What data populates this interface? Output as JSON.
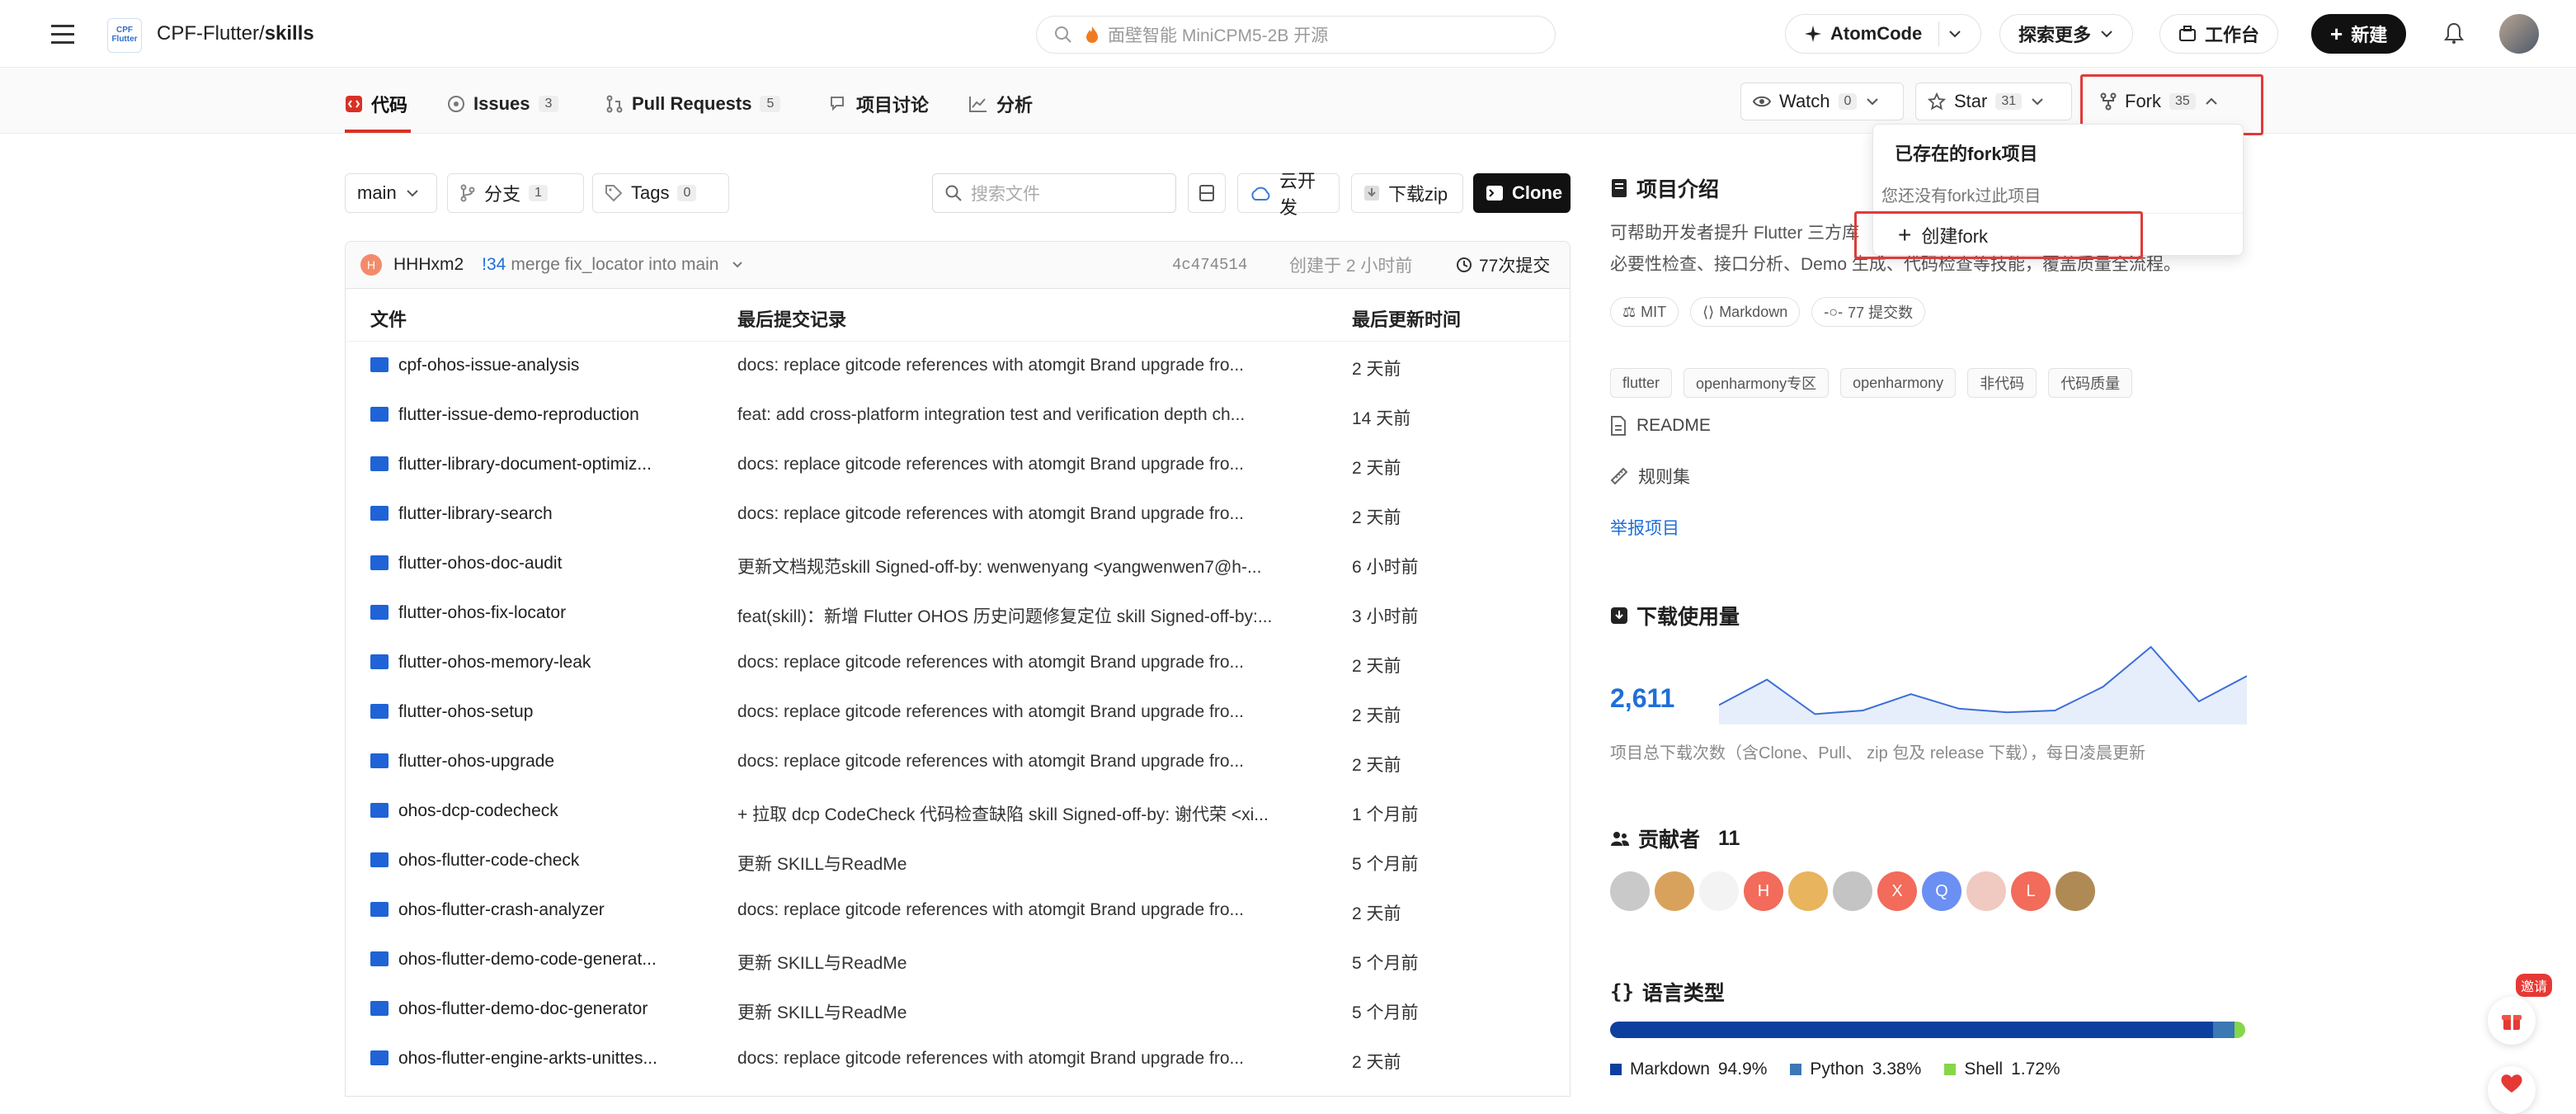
{
  "header": {
    "logo_text": "CPF Flutter",
    "repo_owner": "CPF-Flutter/",
    "repo_name": "skills",
    "search_placeholder": "面壁智能 MiniCPM5-2B 开源",
    "atomcode_label": "AtomCode",
    "explore_label": "探索更多",
    "workspace_label": "工作台",
    "new_label": "新建"
  },
  "tabs": [
    {
      "label": "代码",
      "count": ""
    },
    {
      "label": "Issues",
      "count": "3"
    },
    {
      "label": "Pull Requests",
      "count": "5"
    },
    {
      "label": "项目讨论",
      "count": ""
    },
    {
      "label": "分析",
      "count": ""
    }
  ],
  "repo_actions": {
    "watch_label": "Watch",
    "watch_count": "0",
    "star_label": "Star",
    "star_count": "31",
    "fork_label": "Fork",
    "fork_count": "35"
  },
  "fork_dropdown": {
    "title": "已存在的fork项目",
    "empty_text": "您还没有fork过此项目",
    "create_label": "创建fork"
  },
  "toolbar": {
    "branch": "main",
    "branches_label": "分支",
    "branches_count": "1",
    "tags_label": "Tags",
    "tags_count": "0",
    "file_search_placeholder": "搜索文件",
    "cloud_dev_label": "云开发",
    "download_zip_label": "下载zip",
    "clone_label": "Clone"
  },
  "commit": {
    "avatar_letter": "H",
    "author": "HHHxm2",
    "pr_ref": "!34",
    "message": "merge fix_locator into main",
    "hash": "4c474514",
    "created": "创建于 2 小时前",
    "commit_count": "77次提交"
  },
  "file_table": {
    "headers": [
      "文件",
      "最后提交记录",
      "最后更新时间"
    ],
    "rows": [
      {
        "name": "cpf-ohos-issue-analysis",
        "msg": "docs: replace gitcode references with atomgit Brand upgrade fro...",
        "time": "2 天前"
      },
      {
        "name": "flutter-issue-demo-reproduction",
        "msg": "feat: add cross-platform integration test and verification depth ch...",
        "time": "14 天前"
      },
      {
        "name": "flutter-library-document-optimiz...",
        "msg": "docs: replace gitcode references with atomgit Brand upgrade fro...",
        "time": "2 天前"
      },
      {
        "name": "flutter-library-search",
        "msg": "docs: replace gitcode references with atomgit Brand upgrade fro...",
        "time": "2 天前"
      },
      {
        "name": "flutter-ohos-doc-audit",
        "msg": "更新文档规范skill Signed-off-by: wenwenyang <yangwenwen7@h-...",
        "time": "6 小时前"
      },
      {
        "name": "flutter-ohos-fix-locator",
        "msg": "feat(skill)：新增 Flutter OHOS 历史问题修复定位 skill Signed-off-by:...",
        "time": "3 小时前"
      },
      {
        "name": "flutter-ohos-memory-leak",
        "msg": "docs: replace gitcode references with atomgit Brand upgrade fro...",
        "time": "2 天前"
      },
      {
        "name": "flutter-ohos-setup",
        "msg": "docs: replace gitcode references with atomgit Brand upgrade fro...",
        "time": "2 天前"
      },
      {
        "name": "flutter-ohos-upgrade",
        "msg": "docs: replace gitcode references with atomgit Brand upgrade fro...",
        "time": "2 天前"
      },
      {
        "name": "ohos-dcp-codecheck",
        "msg": "+ 拉取 dcp CodeCheck 代码检查缺陷 skill Signed-off-by: 谢代荣 <xi...",
        "time": "1 个月前"
      },
      {
        "name": "ohos-flutter-code-check",
        "msg": "更新 SKILL与ReadMe",
        "time": "5 个月前"
      },
      {
        "name": "ohos-flutter-crash-analyzer",
        "msg": "docs: replace gitcode references with atomgit Brand upgrade fro...",
        "time": "2 天前"
      },
      {
        "name": "ohos-flutter-demo-code-generat...",
        "msg": "更新 SKILL与ReadMe",
        "time": "5 个月前"
      },
      {
        "name": "ohos-flutter-demo-doc-generator",
        "msg": "更新 SKILL与ReadMe",
        "time": "5 个月前"
      },
      {
        "name": "ohos-flutter-engine-arkts-unittes...",
        "msg": "docs: replace gitcode references with atomgit Brand upgrade fro...",
        "time": "2 天前"
      }
    ]
  },
  "intro": {
    "title": "项目介绍",
    "desc_line1": "可帮助开发者提升 Flutter 三方库",
    "desc_line2": "必要性检查、接口分析、Demo 生成、代码检查等技能，覆盖质量全流程。",
    "license": "MIT",
    "language": "Markdown",
    "commits": "77 提交数",
    "topics": [
      "flutter",
      "openharmony专区",
      "openharmony",
      "非代码",
      "代码质量"
    ],
    "readme": "README",
    "rules": "规则集",
    "report": "举报项目"
  },
  "downloads": {
    "title": "下载使用量",
    "total": "2,611",
    "note": "项目总下载次数（含Clone、Pull、 zip 包及 release 下载），每日凌晨更新",
    "trend": [
      8,
      22,
      3,
      5,
      14,
      6,
      4,
      5,
      18,
      40,
      10,
      24
    ],
    "color": "#3a6fd8"
  },
  "contributors": {
    "title": "贡献者",
    "count": "11",
    "avatars": [
      {
        "letter": "",
        "color": "#c9c9c9"
      },
      {
        "letter": "",
        "color": "#d9a25c"
      },
      {
        "letter": "",
        "color": "#f3f3f3"
      },
      {
        "letter": "H",
        "color": "#f26b5b"
      },
      {
        "letter": "",
        "color": "#e8b45d"
      },
      {
        "letter": "",
        "color": "#c4c4c4"
      },
      {
        "letter": "X",
        "color": "#f26b5b"
      },
      {
        "letter": "Q",
        "color": "#6b8ff2"
      },
      {
        "letter": "",
        "color": "#f0c9c0"
      },
      {
        "letter": "L",
        "color": "#f26b5b"
      },
      {
        "letter": "",
        "color": "#b08a55"
      }
    ]
  },
  "languages": {
    "title": "语言类型",
    "items": [
      {
        "name": "Markdown",
        "pct": "94.9%",
        "value": 94.9,
        "color": "#0d3f9e"
      },
      {
        "name": "Python",
        "pct": "3.38%",
        "value": 3.38,
        "color": "#3b78b4"
      },
      {
        "name": "Shell",
        "pct": "1.72%",
        "value": 1.72,
        "color": "#86d64a"
      }
    ]
  },
  "float": {
    "badge": "邀请"
  }
}
